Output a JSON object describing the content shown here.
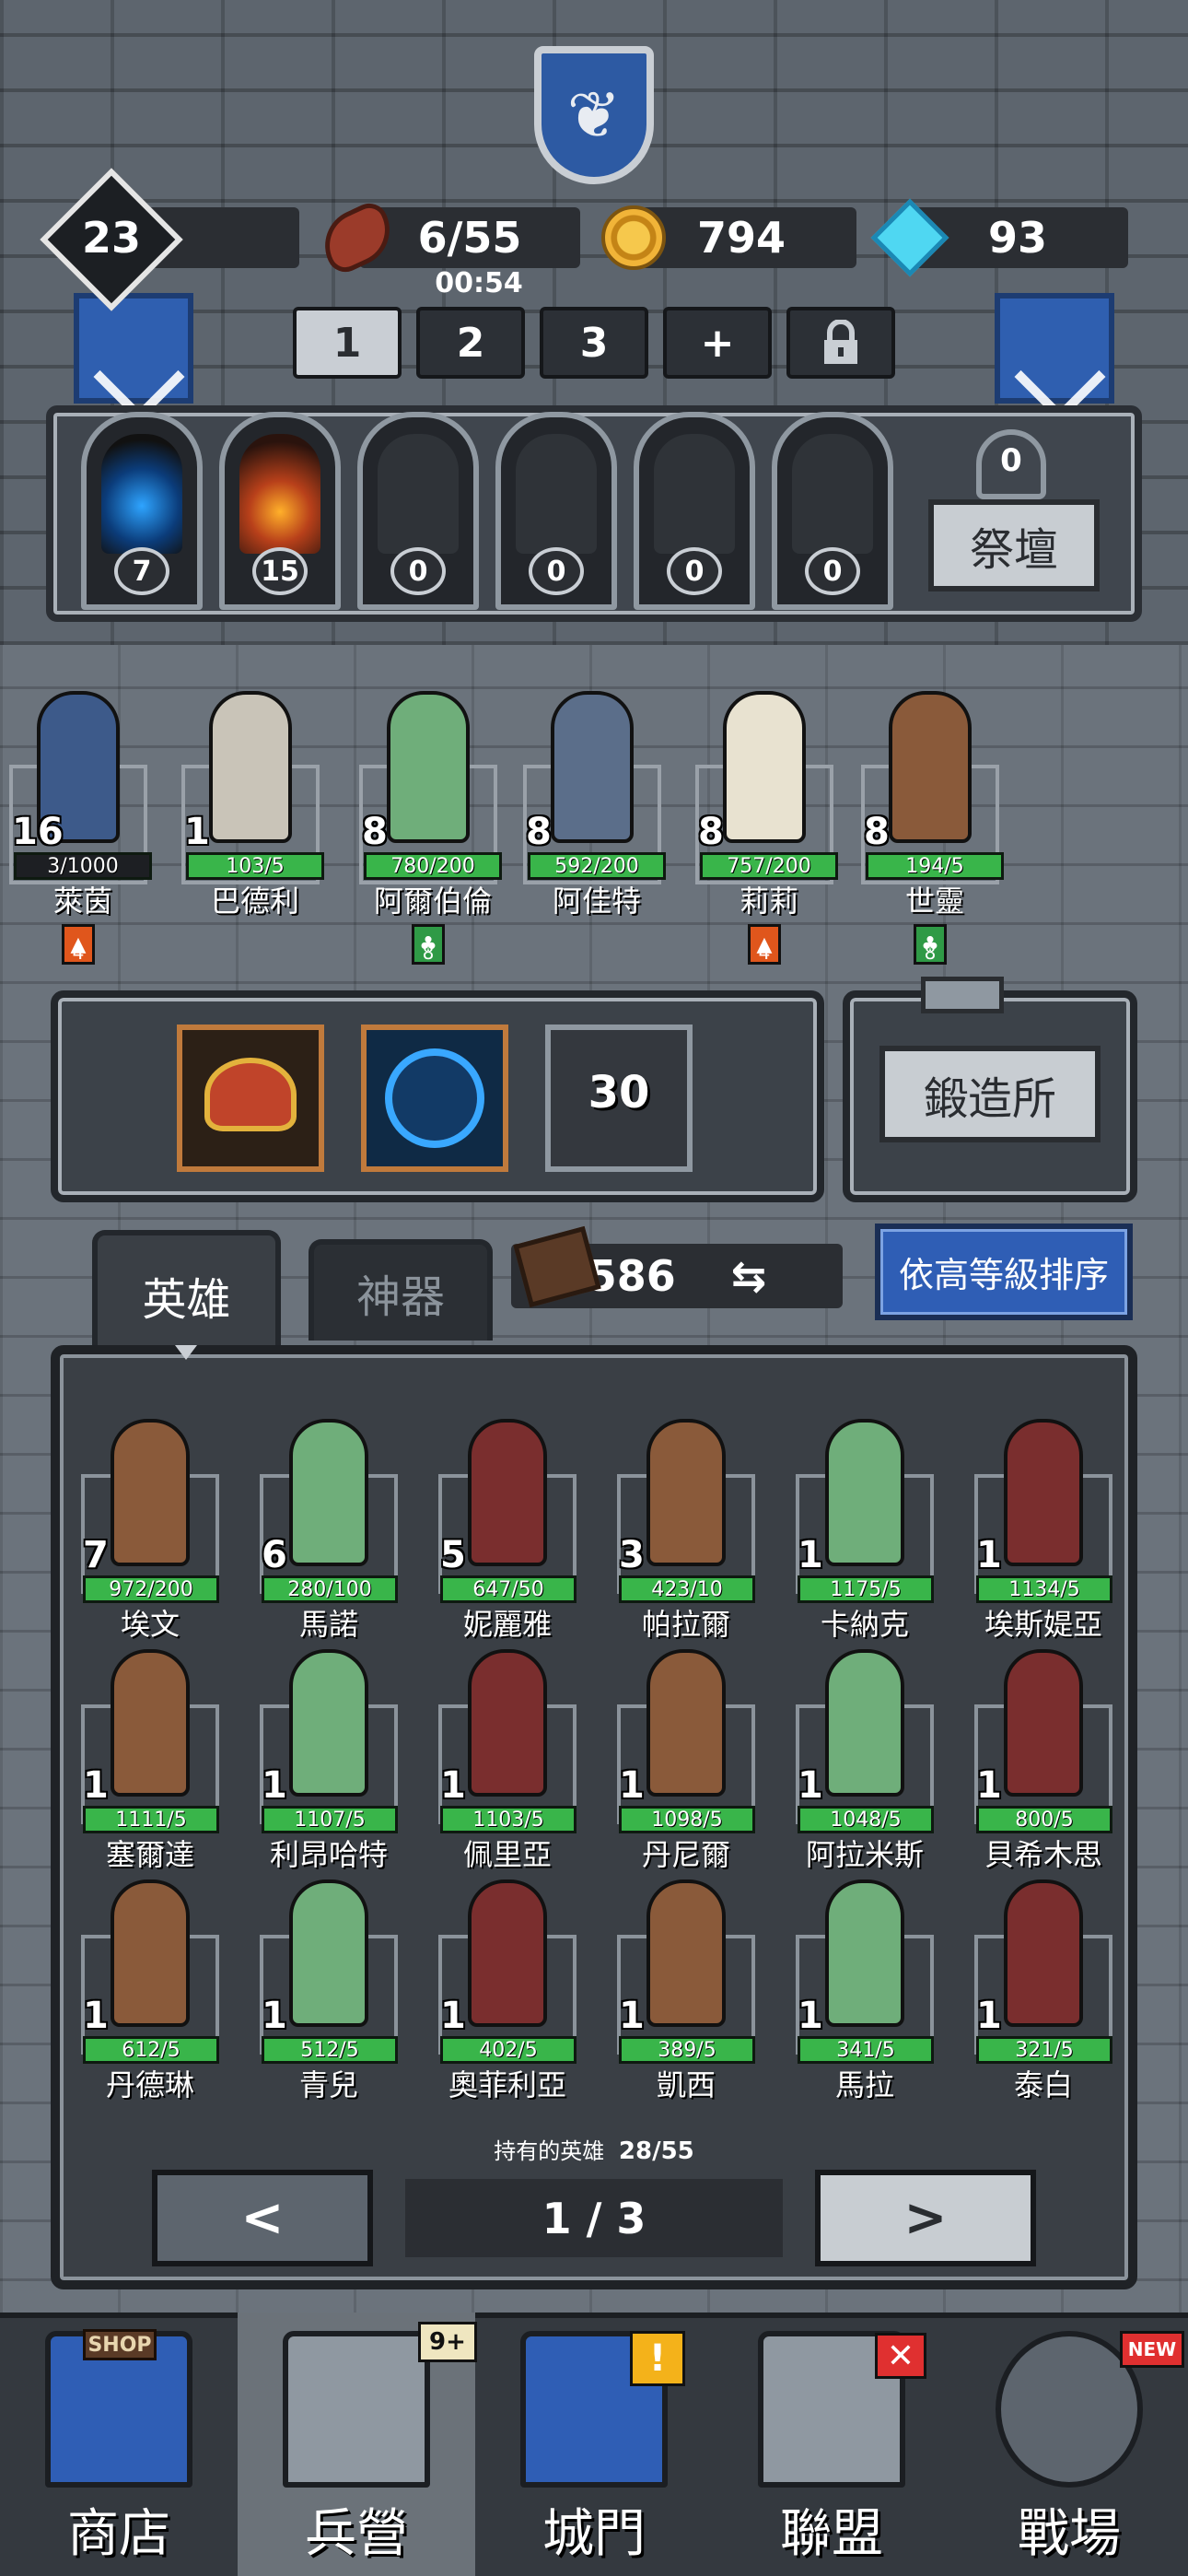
{
  "colors": {
    "xp_green": "#39b54a",
    "sort_blue": "#2f5eb5",
    "tag_orange": "#e0561c",
    "tag_green": "#2f9a46",
    "badge_red": "#e03030",
    "badge_yellow": "#f4b21a"
  },
  "resources": {
    "level": "23",
    "food": "6/55",
    "food_timer": "00:54",
    "gold": "794",
    "gems": "93",
    "food_icon": "meat-icon",
    "gold_icon": "gold-coin-icon",
    "gem_icon": "diamond-icon"
  },
  "team_tabs": [
    "1",
    "2",
    "3",
    "+"
  ],
  "statues": [
    "7",
    "15",
    "0",
    "0",
    "0",
    "0"
  ],
  "altar": {
    "count": "0",
    "label": "祭壇"
  },
  "team": [
    {
      "level": "16",
      "xp": "3/1000",
      "name": "萊茵",
      "tag": "orange",
      "tag_num": "4"
    },
    {
      "level": "1",
      "xp": "103/5",
      "name": "巴德利"
    },
    {
      "level": "8",
      "xp": "780/200",
      "name": "阿爾伯倫",
      "tag": "green",
      "tag_num": "8"
    },
    {
      "level": "8",
      "xp": "592/200",
      "name": "阿佳特"
    },
    {
      "level": "8",
      "xp": "757/200",
      "name": "莉莉",
      "tag": "orange",
      "tag_num": "4"
    },
    {
      "level": "8",
      "xp": "194/5",
      "name": "世靈",
      "tag": "green",
      "tag_num": "8"
    }
  ],
  "artifact_locked_level": "30",
  "forge_label": "鍛造所",
  "tabs": {
    "heroes": "英雄",
    "artifacts": "神器"
  },
  "scroll_count": "586",
  "swap_icon": "⇆",
  "sort_label": "依高等級排序",
  "heroes": [
    {
      "level": "7",
      "xp": "972/200",
      "name": "埃文"
    },
    {
      "level": "6",
      "xp": "280/100",
      "name": "馬諾"
    },
    {
      "level": "5",
      "xp": "647/50",
      "name": "妮麗雅"
    },
    {
      "level": "3",
      "xp": "423/10",
      "name": "帕拉爾"
    },
    {
      "level": "1",
      "xp": "1175/5",
      "name": "卡納克"
    },
    {
      "level": "1",
      "xp": "1134/5",
      "name": "埃斯媞亞"
    },
    {
      "level": "1",
      "xp": "1111/5",
      "name": "塞爾達"
    },
    {
      "level": "1",
      "xp": "1107/5",
      "name": "利昂哈特"
    },
    {
      "level": "1",
      "xp": "1103/5",
      "name": "佩里亞"
    },
    {
      "level": "1",
      "xp": "1098/5",
      "name": "丹尼爾"
    },
    {
      "level": "1",
      "xp": "1048/5",
      "name": "阿拉米斯"
    },
    {
      "level": "1",
      "xp": "800/5",
      "name": "貝希木思"
    },
    {
      "level": "1",
      "xp": "612/5",
      "name": "丹德琳"
    },
    {
      "level": "1",
      "xp": "512/5",
      "name": "青兒"
    },
    {
      "level": "1",
      "xp": "402/5",
      "name": "奧菲利亞"
    },
    {
      "level": "1",
      "xp": "389/5",
      "name": "凱西"
    },
    {
      "level": "1",
      "xp": "341/5",
      "name": "馬拉"
    },
    {
      "level": "1",
      "xp": "321/5",
      "name": "泰白"
    }
  ],
  "owned_label": "持有的英雄",
  "owned_count": "28/55",
  "pager": {
    "prev": "<",
    "next": ">",
    "page": "1 / 3"
  },
  "nav": [
    {
      "label": "商店",
      "badge": "SHOP",
      "icon": "shop-icon"
    },
    {
      "label": "兵營",
      "badge": "9+",
      "icon": "barracks-icon"
    },
    {
      "label": "城門",
      "badge": "!",
      "icon": "castle-gate-icon"
    },
    {
      "label": "聯盟",
      "badge": "✕",
      "icon": "alliance-icon"
    },
    {
      "label": "戰場",
      "badge": "NEW",
      "icon": "battlefield-icon"
    }
  ]
}
